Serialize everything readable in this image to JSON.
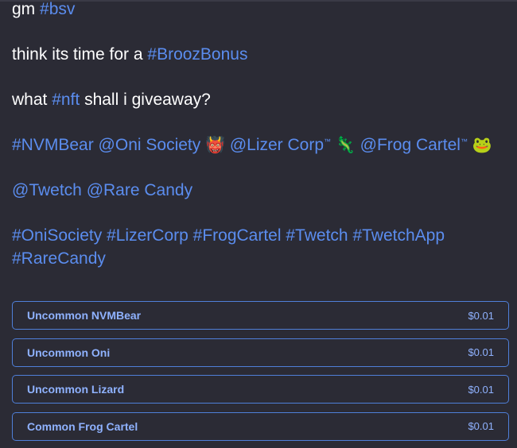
{
  "post": {
    "line1": {
      "text": "gm ",
      "tag": "#bsv"
    },
    "line2": {
      "text": "think its time for a ",
      "tag": "#BroozBonus"
    },
    "line3": {
      "pre": "what ",
      "tag": "#nft",
      "post": " shall i giveaway?"
    },
    "line4": {
      "t1": "#NVMBear",
      "t2": "@Oni Society",
      "e1": "👹",
      "t3": "@Lizer Corp",
      "tm1": "™",
      "e2": "🦎",
      "t4": "@Frog Cartel",
      "tm2": "™",
      "e3": "🐸"
    },
    "line5": {
      "t1": "@Twetch",
      "t2": "@Rare Candy"
    },
    "line6": {
      "t1": "#OniSociety",
      "t2": "#LizerCorp",
      "t3": "#FrogCartel",
      "t4": "#Twetch",
      "t5": "#TwetchApp"
    },
    "line7": {
      "t1": "#RareCandy"
    }
  },
  "options": [
    {
      "label": "Uncommon NVMBear",
      "price": "$0.01"
    },
    {
      "label": "Uncommon Oni",
      "price": "$0.01"
    },
    {
      "label": "Uncommon Lizard",
      "price": "$0.01"
    },
    {
      "label": "Common Frog Cartel",
      "price": "$0.01"
    }
  ],
  "colors": {
    "background": "#2b2b35",
    "link": "#5b8def",
    "option_border": "#4f7fd9",
    "option_text": "#8fb2ff"
  }
}
